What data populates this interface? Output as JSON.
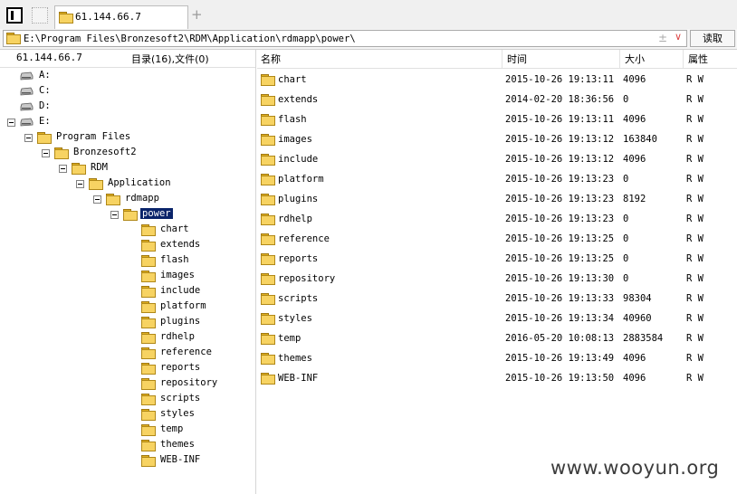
{
  "tabs": [
    {
      "label": "61.144.66.7"
    }
  ],
  "add_tab": "+",
  "path": {
    "value": "E:\\Program Files\\Bronzesoft2\\RDM\\Application\\rdmapp\\power\\",
    "plus": "±",
    "dropdown": "∨",
    "read_label": "读取"
  },
  "left": {
    "ip": "61.144.66.7",
    "summary": "目录(16),文件(0)",
    "drives": [
      {
        "label": "A:"
      },
      {
        "label": "C:"
      },
      {
        "label": "D:"
      },
      {
        "label": "E:"
      }
    ],
    "tree": [
      {
        "label": "Program Files"
      },
      {
        "label": "Bronzesoft2"
      },
      {
        "label": "RDM"
      },
      {
        "label": "Application"
      },
      {
        "label": "rdmapp"
      },
      {
        "label": "power"
      }
    ],
    "children": [
      "chart",
      "extends",
      "flash",
      "images",
      "include",
      "platform",
      "plugins",
      "rdhelp",
      "reference",
      "reports",
      "repository",
      "scripts",
      "styles",
      "temp",
      "themes",
      "WEB-INF"
    ]
  },
  "columns": {
    "name": "名称",
    "time": "时间",
    "size": "大小",
    "attr": "属性"
  },
  "files": [
    {
      "name": "chart",
      "time": "2015-10-26 19:13:11",
      "size": "4096",
      "attr": "R W"
    },
    {
      "name": "extends",
      "time": "2014-02-20 18:36:56",
      "size": "0",
      "attr": "R W"
    },
    {
      "name": "flash",
      "time": "2015-10-26 19:13:11",
      "size": "4096",
      "attr": "R W"
    },
    {
      "name": "images",
      "time": "2015-10-26 19:13:12",
      "size": "163840",
      "attr": "R W"
    },
    {
      "name": "include",
      "time": "2015-10-26 19:13:12",
      "size": "4096",
      "attr": "R W"
    },
    {
      "name": "platform",
      "time": "2015-10-26 19:13:23",
      "size": "0",
      "attr": "R W"
    },
    {
      "name": "plugins",
      "time": "2015-10-26 19:13:23",
      "size": "8192",
      "attr": "R W"
    },
    {
      "name": "rdhelp",
      "time": "2015-10-26 19:13:23",
      "size": "0",
      "attr": "R W"
    },
    {
      "name": "reference",
      "time": "2015-10-26 19:13:25",
      "size": "0",
      "attr": "R W"
    },
    {
      "name": "reports",
      "time": "2015-10-26 19:13:25",
      "size": "0",
      "attr": "R W"
    },
    {
      "name": "repository",
      "time": "2015-10-26 19:13:30",
      "size": "0",
      "attr": "R W"
    },
    {
      "name": "scripts",
      "time": "2015-10-26 19:13:33",
      "size": "98304",
      "attr": "R W"
    },
    {
      "name": "styles",
      "time": "2015-10-26 19:13:34",
      "size": "40960",
      "attr": "R W"
    },
    {
      "name": "temp",
      "time": "2016-05-20 10:08:13",
      "size": "2883584",
      "attr": "R W"
    },
    {
      "name": "themes",
      "time": "2015-10-26 19:13:49",
      "size": "4096",
      "attr": "R W"
    },
    {
      "name": "WEB-INF",
      "time": "2015-10-26 19:13:50",
      "size": "4096",
      "attr": "R W"
    }
  ],
  "watermark": "www.wooyun.org",
  "colors": {
    "selection": "#0a246a",
    "folder": "#f7d362"
  }
}
